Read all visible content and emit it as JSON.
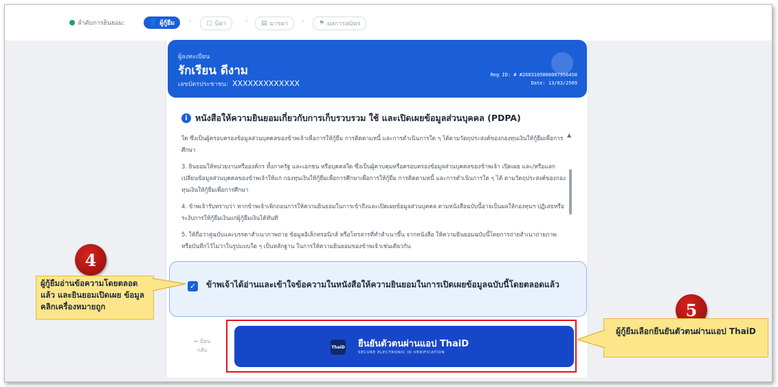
{
  "stepper": {
    "consent_label": "ลำดับการยินยอม:",
    "steps": [
      {
        "label": "ผู้กู้ยืม"
      },
      {
        "label": "บิดา"
      },
      {
        "label": "มารดา"
      },
      {
        "label": "ผลการสมัคร"
      }
    ]
  },
  "header": {
    "registrant_label": "ผู้ลงทะเบียน",
    "name": "รักเรียน ดีงาม",
    "id_label": "เลขบัตรประชาชน:",
    "id_value": "XXXXXXXXXXXXX",
    "reg_id": "Reg ID: # #26031050000079564S0",
    "date": "Date: 13/03/2569"
  },
  "consent": {
    "title": "หนังสือให้ความยินยอมเกี่ยวกับการเก็บรวบรวม ใช้ และเปิดเผยข้อมูลส่วนบุคคล (PDPA)",
    "paragraphs": [
      "ใด ซึ่งเป็นผู้ครอบครองข้อมูลส่วนบุคคลของข้าพเจ้าเพื่อการให้กู้ยืม การติดตามหนี้ และการดำเนินการใด ๆ ได้ตามวัตถุประสงค์ของกองทุนเงินให้กู้ยืมเพื่อการศึกษา",
      "3. ยินยอมให้หน่วยงานหรือองค์กร ทั้งภาครัฐ และเอกชน หรือบุคคลใด ซึ่งเป็นผู้ควบคุมหรือครอบครองข้อมูลส่วนบุคคลของข้าพเจ้า เปิดเผย และ/หรือแลกเปลี่ยนข้อมูลส่วนบุคคลของข้าพเจ้าให้แก่ กองทุนเงินให้กู้ยืมเพื่อการศึกษาเพื่อการให้กู้ยืม การติดตามหนี้ และการดำเนินการใด ๆ ได้ ตามวัตถุประสงค์ของกองทุนเงินให้กู้ยืมเพื่อการศึกษา",
      "4. ข้าพเจ้ารับทราบว่า หากข้าพเจ้าเพิกถอนการให้ความยินยอมในการเข้าถึงและเปิดเผยข้อมูลส่วนบุคคล ตามหนังสือฉบับนี้อาจเป็นผลให้กองทุนฯ ปฏิเสธหรือระงับการให้กู้ยืมเงินแก่ผู้กู้ยืมเงินได้ทันที",
      "5. ให้ถือว่าคู่ฉบับและบรรดาสำเนาภาพถ่าย ข้อมูลอิเล็กทรอนิกส์ หรือโทรสารที่ทำสำเนาขึ้น จากหนังสือ ให้ความยินยอมฉบับนี้โดยการถ่ายสำเนาถ่ายภาพ หรือบันทึกไว้ไม่ว่าในรูปแบบใด ๆ เป็นหลักฐาน ในการให้ความยินยอมของข้าพเจ้าเช่นเดียวกัน"
    ],
    "checkbox_label": "ข้าพเจ้าได้อ่านและเข้าใจข้อความในหนังสือให้ความยินยอมในการเปิดเผยข้อมูลฉบับนี้โดยตลอดแล้ว",
    "checked": true
  },
  "actions": {
    "back_arrow": "← ย้อน",
    "back_text": "กลับ",
    "thaid_logo": "ThaiD",
    "thaid_label": "ยืนยันตัวตนผ่านแอป ThaiD",
    "thaid_sub": "SECURE ELECTRONIC ID VERIFICATION"
  },
  "annotations": {
    "badge_4": "4",
    "callout_4": "ผู้กู้ยืมอ่านข้อความโดยตลอด แล้ว และยินยอมเปิดเผย ข้อมูล คลิกเครื่องหมายถูก",
    "badge_5": "5",
    "callout_5": "ผู้กู้ยืมเลือกยืนยันตัวตนผ่านแอป ThaiD"
  },
  "colors": {
    "primary": "#1a5fd8",
    "button": "#1747c9",
    "highlight_border": "#e0141c",
    "callout_bg": "#fde68a",
    "badge": "#b31410"
  }
}
